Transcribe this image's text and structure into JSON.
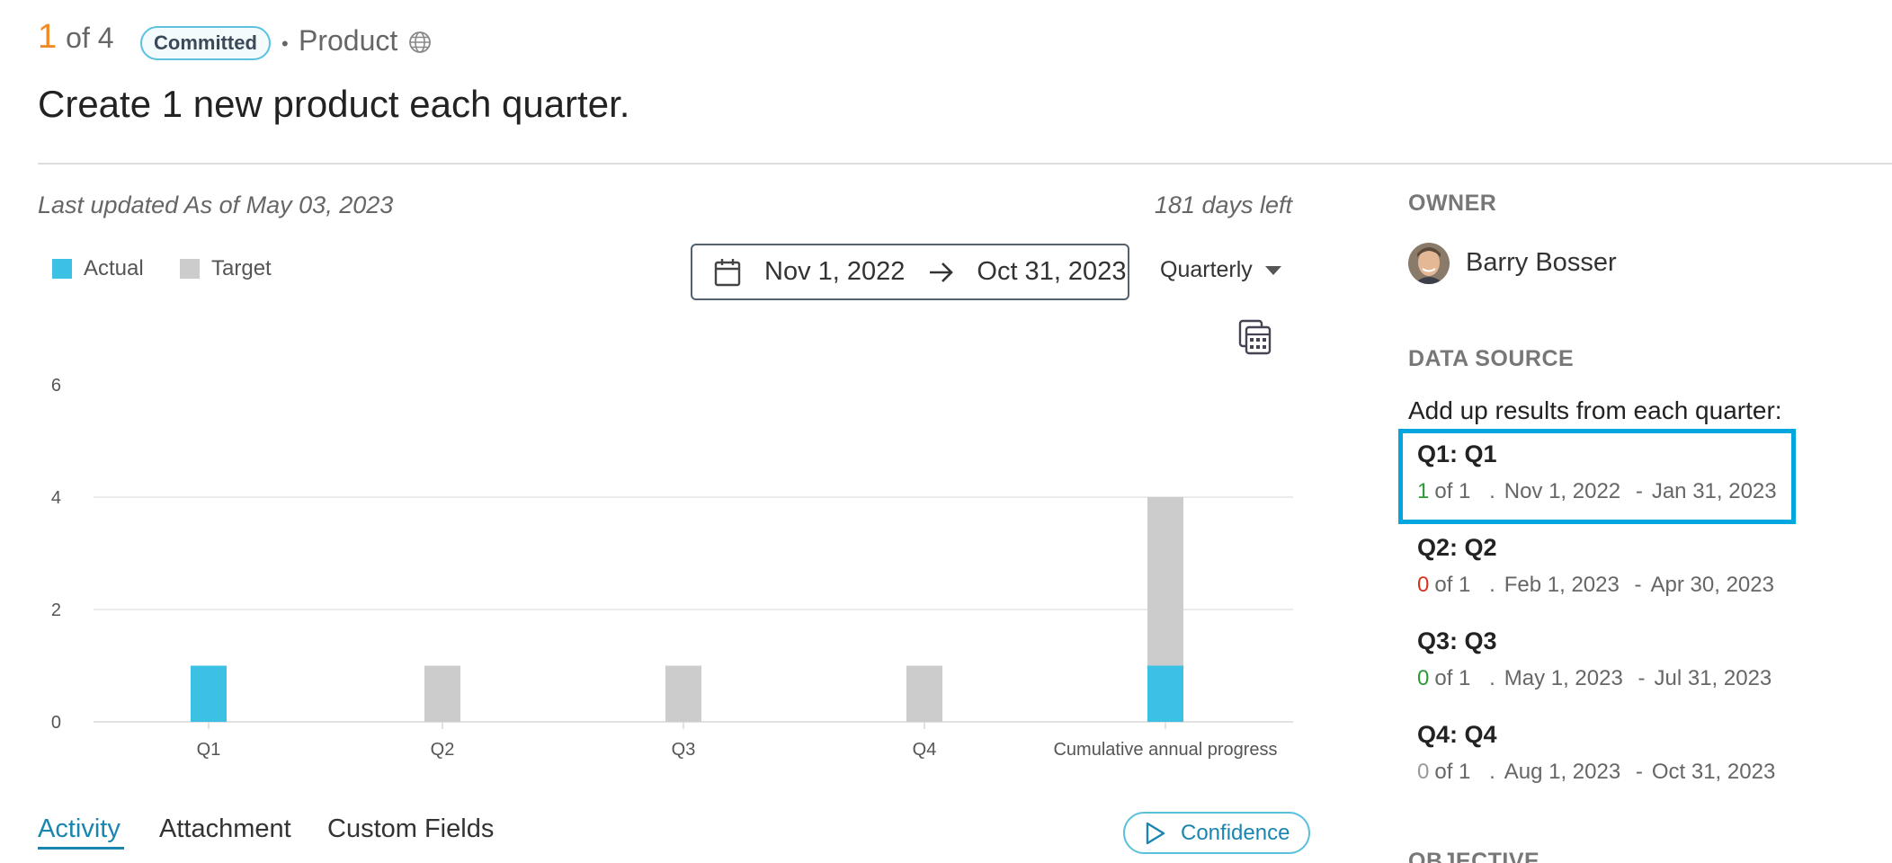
{
  "header": {
    "current": "1",
    "of_total": "of 4",
    "status_badge": "Committed",
    "separator": "•",
    "category": "Product",
    "title": "Create 1 new product each quarter."
  },
  "meta": {
    "last_updated": "Last updated As of May 03, 2023",
    "days_left": "181 days left"
  },
  "legend": {
    "actual": "Actual",
    "target": "Target"
  },
  "date_range": {
    "start": "Nov 1, 2022",
    "end": "Oct 31, 2023",
    "period": "Quarterly"
  },
  "colors": {
    "actual": "#3cc0e4",
    "target": "#cccccc",
    "accent": "#1a86b0",
    "highlight": "#00a6dd",
    "green": "#2e9a3a",
    "red": "#d9321f",
    "gray": "#999999"
  },
  "chart_data": {
    "type": "bar",
    "categories": [
      "Q1",
      "Q2",
      "Q3",
      "Q4",
      "Cumulative annual progress"
    ],
    "series": [
      {
        "name": "Actual",
        "values": [
          1,
          0,
          0,
          0,
          1
        ]
      },
      {
        "name": "Target",
        "values": [
          0,
          1,
          1,
          1,
          3
        ]
      }
    ],
    "stacked": true,
    "ylim": [
      0,
      6
    ],
    "yticks": [
      0,
      2,
      4,
      6
    ],
    "grid": true
  },
  "tabs": {
    "activity": "Activity",
    "attachment": "Attachment",
    "custom_fields": "Custom Fields",
    "confidence": "Confidence"
  },
  "owner": {
    "label": "OWNER",
    "name": "Barry Bosser"
  },
  "data_source": {
    "label": "DATA SOURCE",
    "intro": "Add up results from each quarter:",
    "items": [
      {
        "title": "Q1: Q1",
        "value": "1",
        "of": "of 1",
        "dot": ".",
        "start": "Nov 1, 2022",
        "dash": "-",
        "end": "Jan 31, 2023",
        "status": "green"
      },
      {
        "title": "Q2: Q2",
        "value": "0",
        "of": "of 1",
        "dot": ".",
        "start": "Feb 1, 2023",
        "dash": "-",
        "end": "Apr 30, 2023",
        "status": "red"
      },
      {
        "title": "Q3: Q3",
        "value": "0",
        "of": "of 1",
        "dot": ".",
        "start": "May 1, 2023",
        "dash": "-",
        "end": "Jul 31, 2023",
        "status": "green"
      },
      {
        "title": "Q4: Q4",
        "value": "0",
        "of": "of 1",
        "dot": ".",
        "start": "Aug 1, 2023",
        "dash": "-",
        "end": "Oct 31, 2023",
        "status": "gray"
      }
    ]
  },
  "objective": {
    "label": "OBJECTIVE"
  }
}
